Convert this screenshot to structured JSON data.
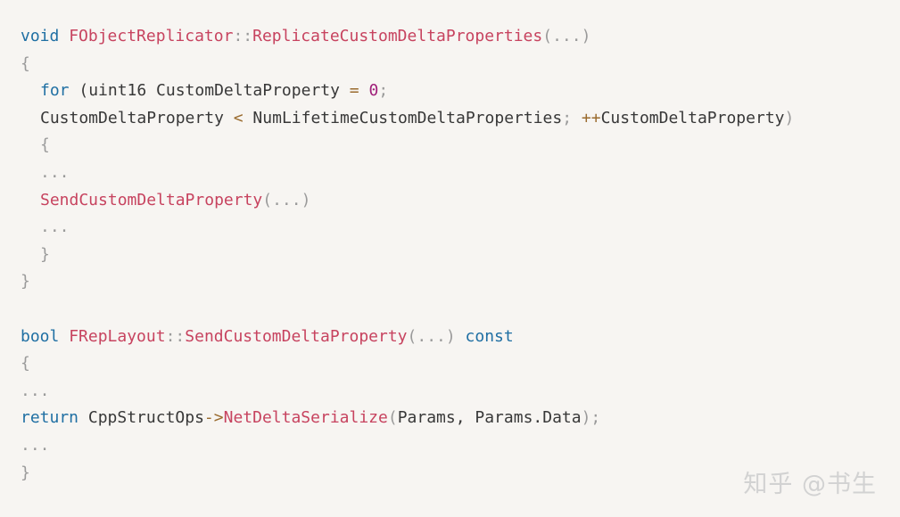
{
  "code": {
    "l1": {
      "kw": "void",
      "cls": "FObjectReplicator",
      "sep": "::",
      "fn": "ReplicateCustomDeltaProperties",
      "args": "(...)"
    },
    "l2": "{",
    "l3": {
      "kw": "for",
      "p1": " (uint16 CustomDeltaProperty ",
      "op": "=",
      "num": "0",
      "semi": ";"
    },
    "l4": {
      "a": "CustomDeltaProperty ",
      "op1": "<",
      "b": " NumLifetimeCustomDeltaProperties",
      "semi": ";",
      "op2": "++",
      "c": "CustomDeltaProperty",
      "close": ")"
    },
    "l5": "{",
    "l6": "...",
    "l7": {
      "fn": "SendCustomDeltaProperty",
      "args": "(...)"
    },
    "l8": "...",
    "l9": "}",
    "l10": "}",
    "l12": {
      "kw": "bool",
      "cls": "FRepLayout",
      "sep": "::",
      "fn": "SendCustomDeltaProperty",
      "args": "(...)",
      "kw2": "const"
    },
    "l13": "{",
    "l14": "...",
    "l15": {
      "kw": "return",
      "obj": " CppStructOps",
      "arrow": "->",
      "fn": "NetDeltaSerialize",
      "open": "(",
      "args": "Params, Params.Data",
      "close": ");"
    },
    "l16": "...",
    "l17": "}"
  },
  "watermark": "知乎 @书生"
}
